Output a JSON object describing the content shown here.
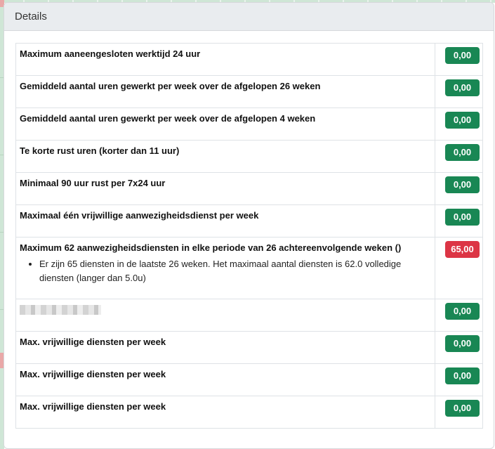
{
  "panel": {
    "title": "Details"
  },
  "rows": [
    {
      "label": "Maximum aaneengesloten werktijd 24 uur",
      "value": "0,00",
      "status": "ok"
    },
    {
      "label": "Gemiddeld aantal uren gewerkt per week over de afgelopen 26 weken",
      "value": "0,00",
      "status": "ok"
    },
    {
      "label": "Gemiddeld aantal uren gewerkt per week over de afgelopen 4 weken",
      "value": "0,00",
      "status": "ok"
    },
    {
      "label": "Te korte rust uren (korter dan 11 uur)",
      "value": "0,00",
      "status": "ok"
    },
    {
      "label": "Minimaal 90 uur rust per 7x24 uur",
      "value": "0,00",
      "status": "ok"
    },
    {
      "label": "Maximaal één vrijwillige aanwezigheidsdienst per week",
      "value": "0,00",
      "status": "ok"
    },
    {
      "label": "Maximum 62 aanwezigheidsdiensten in elke periode van 26 achtereenvolgende weken ()",
      "value": "65,00",
      "status": "bad",
      "details": [
        "Er zijn 65 diensten in de laatste 26 weken. Het maximaal aantal diensten is 62.0 volledige diensten (langer dan 5.0u)"
      ]
    },
    {
      "label": "",
      "value": "0,00",
      "status": "ok",
      "redacted": true
    },
    {
      "label": "Max. vrijwillige diensten per week",
      "value": "0,00",
      "status": "ok"
    },
    {
      "label": "Max. vrijwillige diensten per week",
      "value": "0,00",
      "status": "ok"
    },
    {
      "label": "Max. vrijwillige diensten per week",
      "value": "0,00",
      "status": "ok"
    }
  ],
  "colors": {
    "ok": "#198754",
    "bad": "#dc3545"
  }
}
